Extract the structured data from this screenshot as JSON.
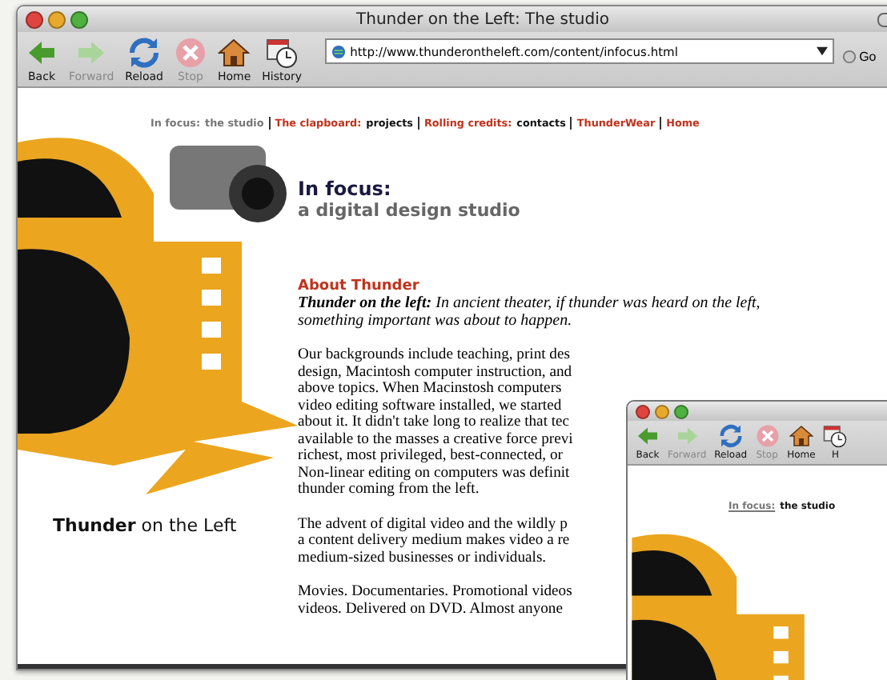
{
  "window": {
    "title": "Thunder on the Left: The studio"
  },
  "toolbar": [
    {
      "label": "Back",
      "kind": "back",
      "disabled": false
    },
    {
      "label": "Forward",
      "kind": "forward",
      "disabled": true
    },
    {
      "label": "Reload",
      "kind": "reload",
      "disabled": false
    },
    {
      "label": "Stop",
      "kind": "stop",
      "disabled": true
    },
    {
      "label": "Home",
      "kind": "home",
      "disabled": false
    },
    {
      "label": "History",
      "kind": "history",
      "disabled": false
    }
  ],
  "address": {
    "value": "http://www.thunderontheleft.com/content/infocus.html",
    "go": "Go"
  },
  "nav": [
    {
      "title": "In focus:",
      "subtitle": "the studio",
      "selected": true
    },
    {
      "title": "The clapboard:",
      "subtitle": "projects",
      "selected": false
    },
    {
      "title": "Rolling credits:",
      "subtitle": "contacts",
      "selected": false
    },
    {
      "title": "ThunderWear",
      "selected": false
    },
    {
      "title": "Home",
      "selected": false
    }
  ],
  "logo": {
    "strong": "Thunder",
    "rest": "on the Left"
  },
  "heading": {
    "title": "In focus:",
    "subtitle": "a digital design studio"
  },
  "about": {
    "title": "About Thunder",
    "lead": "**Thunder on the left:** In ancient theater, if thunder was heard on the left, something important was about to happen.",
    "paragraphs": [
      [
        "Our backgrounds include teaching, print des",
        "design, Macintosh computer instruction, and",
        "above topics. When Macinstosh computers",
        "video editing software installed, we started",
        "about it. It didn't take long to realize that tec",
        "available to the masses a creative force previ",
        "richest, most privileged, best-connected, or",
        "Non-linear editing on computers was definit",
        "thunder coming from the left."
      ],
      [
        "The advent of digital video and the wildly p",
        "a content delivery medium makes video a re",
        "medium-sized businesses or individuals."
      ],
      [
        "Movies. Documentaries. Promotional videos",
        "videos. Delivered on DVD. Almost anyone"
      ]
    ]
  },
  "second_window": {
    "toolbar": [
      {
        "label": "Back",
        "kind": "back",
        "disabled": false
      },
      {
        "label": "Forward",
        "kind": "forward",
        "disabled": true
      },
      {
        "label": "Reload",
        "kind": "reload",
        "disabled": false
      },
      {
        "label": "Stop",
        "kind": "stop",
        "disabled": true
      },
      {
        "label": "Home",
        "kind": "home",
        "disabled": false
      },
      {
        "label": "H",
        "kind": "history",
        "disabled": false
      }
    ],
    "nav": [
      {
        "title": "In focus:",
        "subtitle": "the studio",
        "selected": true
      }
    ]
  }
}
